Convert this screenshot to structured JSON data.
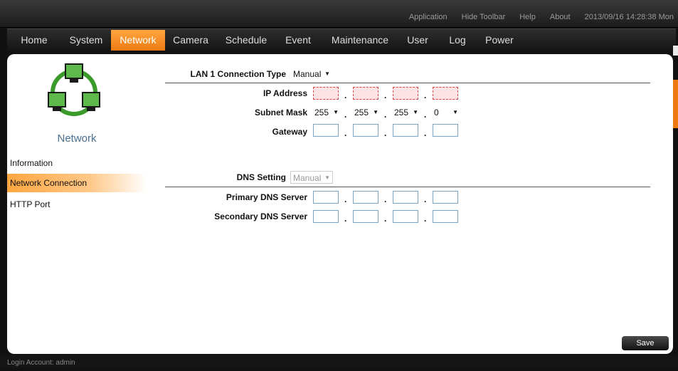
{
  "topbar": {
    "links": [
      "Application",
      "Hide Toolbar",
      "Help",
      "About"
    ],
    "datetime": "2013/09/16 14:28:38 Mon"
  },
  "nav": {
    "tabs": [
      "Home",
      "System",
      "Network",
      "Camera",
      "Schedule",
      "Event",
      "Maintenance",
      "User",
      "Log",
      "Power"
    ],
    "active": "Network"
  },
  "sidebar": {
    "title": "Network",
    "items": [
      "Information",
      "Network Connection",
      "HTTP Port"
    ],
    "active": "Network Connection"
  },
  "form": {
    "lan_label": "LAN 1 Connection Type",
    "lan_value": "Manual",
    "ip_label": "IP Address",
    "subnet_label": "Subnet Mask",
    "subnet_values": [
      "255",
      "255",
      "255",
      "0"
    ],
    "gateway_label": "Gateway",
    "dns_label": "DNS Setting",
    "dns_value": "Manual",
    "primary_dns_label": "Primary DNS Server",
    "secondary_dns_label": "Secondary DNS Server",
    "dot": "."
  },
  "save_label": "Save",
  "status": {
    "login": "Login Account: admin"
  },
  "colors": {
    "accent": "#ee7a10",
    "error_fill": "#fde3e3",
    "error_border": "#d84848",
    "input_border": "#7aa4c4"
  }
}
